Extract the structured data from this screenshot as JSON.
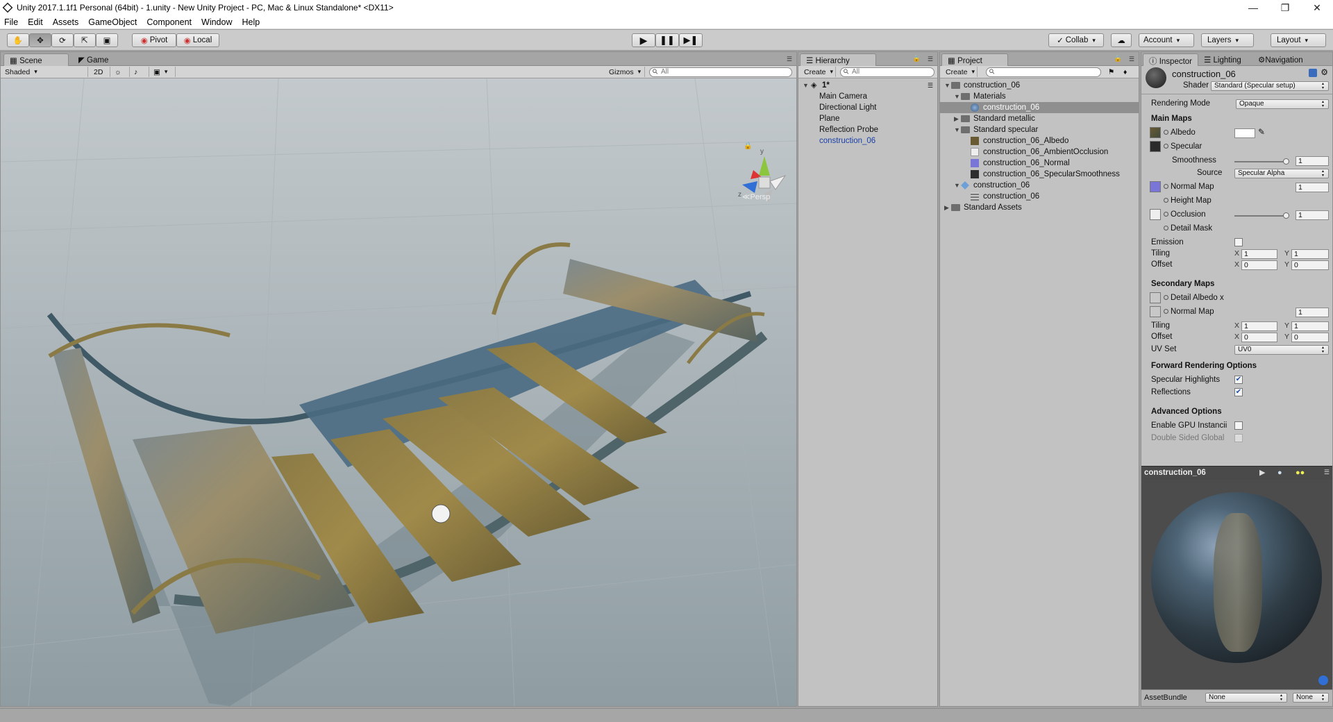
{
  "window": {
    "title": "Unity 2017.1.1f1 Personal (64bit) - 1.unity - New Unity Project - PC, Mac & Linux Standalone* <DX11>",
    "controls": [
      "—",
      "❐",
      "✕"
    ]
  },
  "menu": [
    "File",
    "Edit",
    "Assets",
    "GameObject",
    "Component",
    "Window",
    "Help"
  ],
  "toolbar": {
    "pivot": "Pivot",
    "local": "Local",
    "collab": "Collab",
    "account": "Account",
    "layers": "Layers",
    "layout": "Layout"
  },
  "scene": {
    "tab_scene": "Scene",
    "tab_game": "Game",
    "shading": "Shaded",
    "mode2d": "2D",
    "gizmos": "Gizmos",
    "search_placeholder": "All",
    "persp": "Persp",
    "gizmo_y": "y",
    "gizmo_z": "z"
  },
  "hierarchy": {
    "tab": "Hierarchy",
    "create": "Create",
    "search_placeholder": "All",
    "scene_name": "1*",
    "items": [
      "Main Camera",
      "Directional Light",
      "Plane",
      "Reflection Probe",
      "construction_06"
    ]
  },
  "project": {
    "tab": "Project",
    "create": "Create",
    "tree": [
      {
        "label": "construction_06",
        "depth": 0
      },
      {
        "label": "Materials",
        "depth": 1
      },
      {
        "label": "construction_06",
        "depth": 2
      },
      {
        "label": "Standard metallic",
        "depth": 1
      },
      {
        "label": "Standard specular",
        "depth": 1
      },
      {
        "label": "construction_06_Albedo",
        "depth": 2
      },
      {
        "label": "construction_06_AmbientOcclusion",
        "depth": 2
      },
      {
        "label": "construction_06_Normal",
        "depth": 2
      },
      {
        "label": "construction_06_SpecularSmoothness",
        "depth": 2
      },
      {
        "label": "construction_06",
        "depth": 1
      },
      {
        "label": "construction_06",
        "depth": 2
      },
      {
        "label": "Standard Assets",
        "depth": 0
      }
    ]
  },
  "inspector": {
    "tab": "Inspector",
    "tab_lighting": "Lighting",
    "tab_navigation": "Navigation",
    "material_name": "construction_06",
    "shader_label": "Shader",
    "shader_value": "Standard (Specular setup)",
    "rendering_mode_label": "Rendering Mode",
    "rendering_mode_value": "Opaque",
    "main_maps": "Main Maps",
    "albedo": "Albedo",
    "specular": "Specular",
    "smoothness": "Smoothness",
    "smoothness_value": "1",
    "source_label": "Source",
    "source_value": "Specular Alpha",
    "normal_map": "Normal Map",
    "normal_value": "1",
    "height_map": "Height Map",
    "occlusion": "Occlusion",
    "occlusion_value": "1",
    "detail_mask": "Detail Mask",
    "emission": "Emission",
    "tiling": "Tiling",
    "offset": "Offset",
    "x": "X",
    "y": "Y",
    "tiling_x": "1",
    "tiling_y": "1",
    "offset_x": "0",
    "offset_y": "0",
    "secondary_maps": "Secondary Maps",
    "detail_albedo": "Detail Albedo x",
    "normal_map2": "Normal Map",
    "normal2_value": "1",
    "tiling2_x": "1",
    "tiling2_y": "1",
    "offset2_x": "0",
    "offset2_y": "0",
    "uv_set_label": "UV Set",
    "uv_set_value": "UV0",
    "forward_opts": "Forward Rendering Options",
    "specular_highlights": "Specular Highlights",
    "reflections": "Reflections",
    "advanced": "Advanced Options",
    "gpu_instancing": "Enable GPU Instancii",
    "double_sided": "Double Sided Global",
    "preview_name": "construction_06",
    "assetbundle_label": "AssetBundle",
    "assetbundle_value": "None",
    "assetbundle_variant": "None"
  }
}
